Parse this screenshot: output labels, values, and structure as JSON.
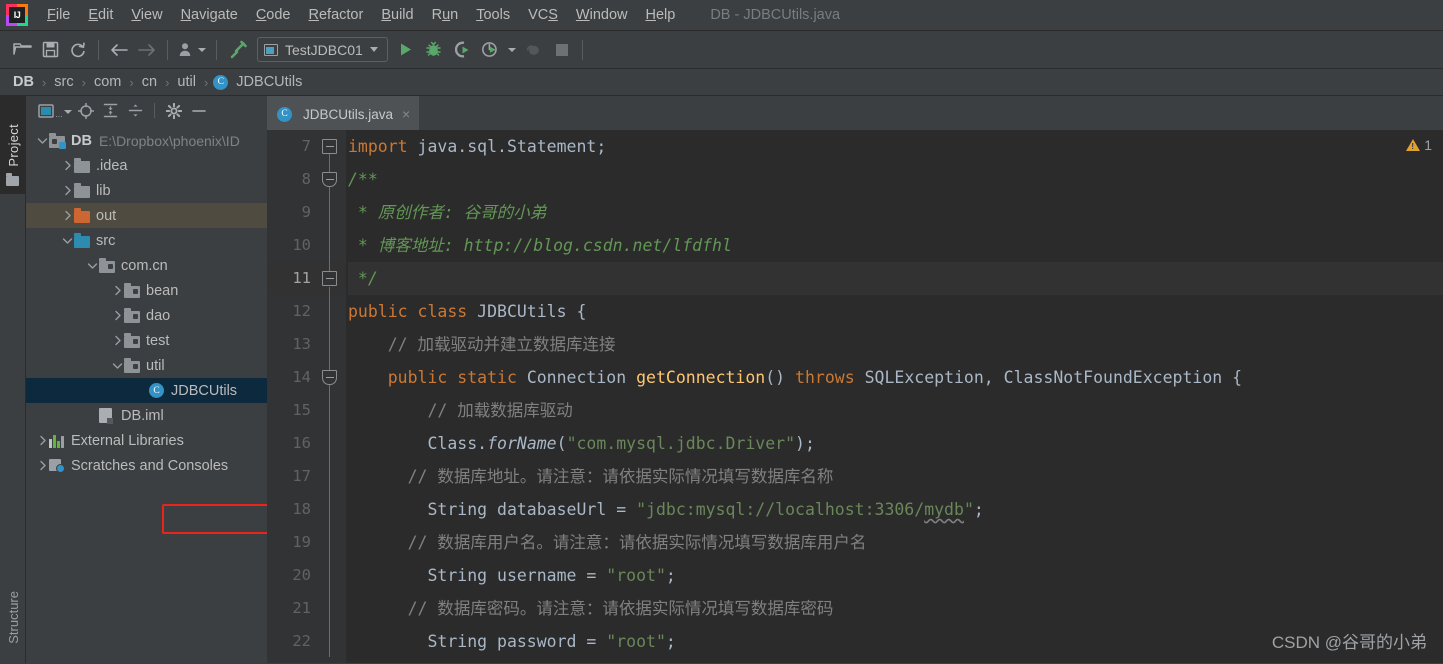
{
  "window": {
    "title": "DB - JDBCUtils.java"
  },
  "menubar": {
    "items": [
      {
        "label": "File",
        "mnemonic": "F"
      },
      {
        "label": "Edit",
        "mnemonic": "E"
      },
      {
        "label": "View",
        "mnemonic": "V"
      },
      {
        "label": "Navigate",
        "mnemonic": "N"
      },
      {
        "label": "Code",
        "mnemonic": "C"
      },
      {
        "label": "Refactor",
        "mnemonic": "R"
      },
      {
        "label": "Build",
        "mnemonic": "B"
      },
      {
        "label": "Run",
        "mnemonic": "u"
      },
      {
        "label": "Tools",
        "mnemonic": "T"
      },
      {
        "label": "VCS",
        "mnemonic": "S"
      },
      {
        "label": "Window",
        "mnemonic": "W"
      },
      {
        "label": "Help",
        "mnemonic": "H"
      }
    ]
  },
  "toolbar": {
    "open_icon": "open-folder-icon",
    "save_icon": "save-icon",
    "sync_icon": "sync-icon",
    "back_icon": "back-arrow-icon",
    "forward_icon": "forward-arrow-icon",
    "vcs_icon": "vcs-update-icon",
    "make_icon": "build-hammer-icon",
    "run_config": "TestJDBC01",
    "run_icon": "run-icon",
    "debug_icon": "debug-icon",
    "coverage_icon": "run-with-coverage-icon",
    "profile_icon": "profile-icon",
    "attach_icon": "attach-debugger-icon",
    "stop_icon": "stop-icon"
  },
  "breadcrumbs": {
    "items": [
      "DB",
      "src",
      "com",
      "cn",
      "util",
      "JDBCUtils"
    ],
    "separator": "›",
    "class_badge": "C"
  },
  "left_stripe": {
    "project_tab": "Project",
    "structure_tab": "Structure"
  },
  "project_panel": {
    "toolbar_icons": [
      "project-view-selector-icon",
      "locate-icon",
      "expand-all-icon",
      "collapse-all-icon",
      "settings-gear-icon",
      "hide-panel-icon"
    ],
    "tree": [
      {
        "label": "DB",
        "sub": "E:\\Dropbox\\phoenix\\ID",
        "indent": 0,
        "arrow": "down",
        "icon": "module-folder-icon",
        "state": "normal",
        "bold": true
      },
      {
        "label": ".idea",
        "sub": "",
        "indent": 1,
        "arrow": "right",
        "icon": "folder-gray-icon",
        "state": "normal",
        "bold": false
      },
      {
        "label": "lib",
        "sub": "",
        "indent": 1,
        "arrow": "right",
        "icon": "folder-gray-icon",
        "state": "normal",
        "bold": false
      },
      {
        "label": "out",
        "sub": "",
        "indent": 1,
        "arrow": "right",
        "icon": "folder-orange-icon",
        "state": "highlight",
        "bold": false
      },
      {
        "label": "src",
        "sub": "",
        "indent": 1,
        "arrow": "down",
        "icon": "folder-blue-icon",
        "state": "normal",
        "bold": false
      },
      {
        "label": "com.cn",
        "sub": "",
        "indent": 2,
        "arrow": "down",
        "icon": "package-icon",
        "state": "normal",
        "bold": false
      },
      {
        "label": "bean",
        "sub": "",
        "indent": 3,
        "arrow": "right",
        "icon": "package-icon",
        "state": "normal",
        "bold": false
      },
      {
        "label": "dao",
        "sub": "",
        "indent": 3,
        "arrow": "right",
        "icon": "package-icon",
        "state": "normal",
        "bold": false
      },
      {
        "label": "test",
        "sub": "",
        "indent": 3,
        "arrow": "right",
        "icon": "package-icon",
        "state": "normal",
        "bold": false
      },
      {
        "label": "util",
        "sub": "",
        "indent": 3,
        "arrow": "down",
        "icon": "package-icon",
        "state": "normal",
        "bold": false
      },
      {
        "label": "JDBCUtils",
        "sub": "",
        "indent": 4,
        "arrow": "none",
        "icon": "java-class-icon",
        "state": "selected",
        "bold": false
      },
      {
        "label": "DB.iml",
        "sub": "",
        "indent": 2,
        "arrow": "none",
        "icon": "iml-file-icon",
        "state": "normal",
        "bold": false
      },
      {
        "label": "External Libraries",
        "sub": "",
        "indent": 0,
        "arrow": "right",
        "icon": "libraries-icon",
        "state": "normal",
        "bold": false
      },
      {
        "label": "Scratches and Consoles",
        "sub": "",
        "indent": 0,
        "arrow": "right",
        "icon": "scratches-icon",
        "state": "normal",
        "bold": false
      }
    ]
  },
  "editor": {
    "tab": {
      "label": "JDBCUtils.java",
      "close": "×",
      "icon": "java-class-icon"
    },
    "inspection": {
      "icon": "warning-triangle-icon",
      "count": "1"
    },
    "current_line": 11,
    "lines": [
      {
        "n": "7",
        "tokens": [
          {
            "t": "import ",
            "c": "kw"
          },
          {
            "t": "java.sql.Statement;",
            "c": "txt"
          }
        ],
        "indent": 0
      },
      {
        "n": "8",
        "tokens": [
          {
            "t": "/**",
            "c": "doc"
          }
        ],
        "indent": 0
      },
      {
        "n": "9",
        "tokens": [
          {
            "t": " * 原创作者: 谷哥的小弟",
            "c": "doc"
          }
        ],
        "indent": 0
      },
      {
        "n": "10",
        "tokens": [
          {
            "t": " * 博客地址: http://blog.csdn.net/lfdfhl",
            "c": "doc"
          }
        ],
        "indent": 0
      },
      {
        "n": "11",
        "tokens": [
          {
            "t": " */",
            "c": "doc"
          }
        ],
        "indent": 0
      },
      {
        "n": "12",
        "tokens": [
          {
            "t": "public class ",
            "c": "kw"
          },
          {
            "t": "JDBCUtils {",
            "c": "txt"
          }
        ],
        "indent": 0
      },
      {
        "n": "13",
        "tokens": [
          {
            "t": "    // 加载驱动并建立数据库连接",
            "c": "cm"
          }
        ],
        "indent": 0
      },
      {
        "n": "14",
        "tokens": [
          {
            "t": "    public static ",
            "c": "kw"
          },
          {
            "t": "Connection ",
            "c": "txt"
          },
          {
            "t": "getConnection",
            "c": "mth"
          },
          {
            "t": "() ",
            "c": "txt"
          },
          {
            "t": "throws ",
            "c": "kw"
          },
          {
            "t": "SQLException, ClassNotFoundException {",
            "c": "txt"
          }
        ],
        "indent": 0
      },
      {
        "n": "15",
        "tokens": [
          {
            "t": "        // 加载数据库驱动",
            "c": "cm"
          }
        ],
        "indent": 0
      },
      {
        "n": "16",
        "tokens": [
          {
            "t": "        Class.",
            "c": "txt"
          },
          {
            "t": "forName",
            "c": "ital"
          },
          {
            "t": "(",
            "c": "txt"
          },
          {
            "t": "\"com.mysql.jdbc.Driver\"",
            "c": "str"
          },
          {
            "t": ");",
            "c": "txt"
          }
        ],
        "indent": 0
      },
      {
        "n": "17",
        "tokens": [
          {
            "t": "      // 数据库地址。请注意：请依据实际情况填写数据库名称",
            "c": "cm"
          }
        ],
        "indent": 0
      },
      {
        "n": "18",
        "tokens": [
          {
            "t": "        String databaseUrl = ",
            "c": "txt"
          },
          {
            "t": "\"jdbc:mysql://localhost:3306/mydb\"",
            "c": "str"
          },
          {
            "t": ";",
            "c": "txt"
          }
        ],
        "indent": 0
      },
      {
        "n": "19",
        "tokens": [
          {
            "t": "      // 数据库用户名。请注意：请依据实际情况填写数据库用户名",
            "c": "cm"
          }
        ],
        "indent": 0
      },
      {
        "n": "20",
        "tokens": [
          {
            "t": "        String username = ",
            "c": "txt"
          },
          {
            "t": "\"root\"",
            "c": "str"
          },
          {
            "t": ";",
            "c": "txt"
          }
        ],
        "indent": 0
      },
      {
        "n": "21",
        "tokens": [
          {
            "t": "      // 数据库密码。请注意：请依据实际情况填写数据库密码",
            "c": "cm"
          }
        ],
        "indent": 0
      },
      {
        "n": "22",
        "tokens": [
          {
            "t": "        String password = ",
            "c": "txt"
          },
          {
            "t": "\"root\"",
            "c": "str"
          },
          {
            "t": ";",
            "c": "txt"
          }
        ],
        "indent": 0
      }
    ]
  },
  "watermark": {
    "text": "CSDN @谷哥的小弟"
  },
  "colors": {
    "chrome": "#3c3f41",
    "editor_bg": "#2b2b2b",
    "gutter_bg": "#313335",
    "selected_row": "#0d293e",
    "highlight_row": "#4f4b41",
    "annotation_red": "#e8241b",
    "accent_blue": "#3592c4",
    "keyword_orange": "#cc7832",
    "string_green": "#6a8759",
    "javadoc_green": "#629755",
    "comment_gray": "#808080",
    "method_yellow": "#ffc66d",
    "run_green": "#59a869",
    "warning_yellow": "#e0a22c"
  }
}
